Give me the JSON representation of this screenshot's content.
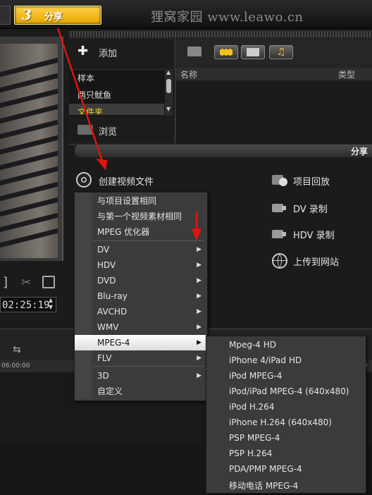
{
  "header": {
    "step_number": "3",
    "step_label": "分享",
    "watermark": "狸窝家园 www.leawo.cn"
  },
  "preview": {
    "timecode": "02:25:19",
    "bracket": "]"
  },
  "library": {
    "add_label": "添加",
    "folders": [
      "样本",
      "两只鱿鱼",
      "文件夹"
    ],
    "browse_label": "浏览",
    "columns": {
      "name": "名称",
      "type": "类型"
    },
    "collapse_glyph": "≪"
  },
  "share": {
    "title": "分享",
    "create_video": "创建视频文件",
    "project_playback": "项目回放",
    "dv_record": "DV 录制",
    "hdv_record": "HDV 录制",
    "upload_web": "上传到网站"
  },
  "timeline": {
    "ruler_start": "06:00:00",
    "ruler_end": "0"
  },
  "menu": {
    "items": [
      {
        "label": "与项目设置相同",
        "submenu": false
      },
      {
        "label": "与第一个视频素材相同",
        "submenu": false
      },
      {
        "label": "MPEG 优化器",
        "submenu": false
      },
      {
        "label": "DV",
        "submenu": true
      },
      {
        "label": "HDV",
        "submenu": true
      },
      {
        "label": "DVD",
        "submenu": true
      },
      {
        "label": "Blu-ray",
        "submenu": true
      },
      {
        "label": "AVCHD",
        "submenu": true
      },
      {
        "label": "WMV",
        "submenu": true
      },
      {
        "label": "MPEG-4",
        "submenu": true,
        "active": true
      },
      {
        "label": "FLV",
        "submenu": true
      },
      {
        "label": "3D",
        "submenu": true
      },
      {
        "label": "自定义",
        "submenu": false
      }
    ],
    "submenu_items": [
      "Mpeg-4 HD",
      "iPhone 4/iPad HD",
      "iPod MPEG-4",
      "iPod/iPad MPEG-4 (640x480)",
      "iPod H.264",
      "iPhone H.264 (640x480)",
      "PSP MPEG-4",
      "PSP H.264",
      "PDA/PMP MPEG-4",
      "移动电话 MPEG-4"
    ]
  },
  "colors": {
    "step_tab": "#f2b81a",
    "annotation_arrow": "#e0130f",
    "menu_bg": "#3b3b3b",
    "menu_active": "#ffffff"
  }
}
